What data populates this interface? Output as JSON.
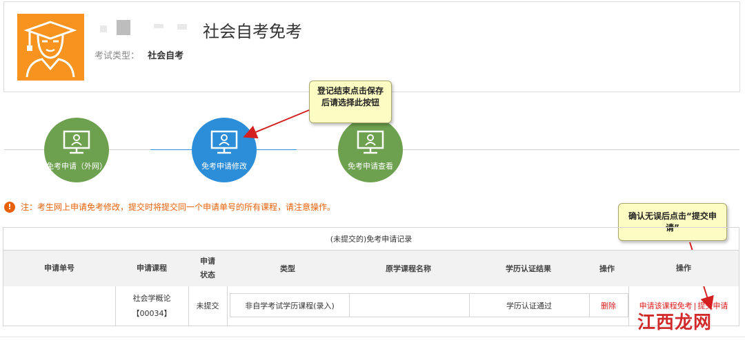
{
  "header": {
    "title": "社会自考免考",
    "exam_type_label": "考试类型：",
    "exam_type_value": "社会自考",
    "avatar_icon": "graduate-avatar-icon",
    "avatar_color": "#f7931e"
  },
  "steps": [
    {
      "label": "免考申请（外网）",
      "state": "done",
      "icon": "monitor-user-icon"
    },
    {
      "label": "免考申请修改",
      "state": "current",
      "icon": "monitor-user-icon"
    },
    {
      "label": "免考申请查看",
      "state": "done",
      "icon": "monitor-user-icon"
    }
  ],
  "callouts": {
    "save_tip": "登记结束点击保存后请选择此按钮",
    "submit_tip": "确认无误后点击“提交申请”"
  },
  "notice": {
    "text": "注：考生网上申请免考修改，提交时将提交同一个申请单号的所有课程，请注意操作。"
  },
  "table": {
    "caption": "(未提交的)免考申请记录",
    "headers": {
      "apply_no": "申请单号",
      "course": "申请课程",
      "status": "申请状态",
      "type": "类型",
      "orig_course": "原学课程名称",
      "cert_result": "学历认证结果",
      "inner_op": "操作",
      "op": "操作"
    },
    "rows": [
      {
        "apply_no": "",
        "course_name": "社会学概论",
        "course_code": "【00034】",
        "status": "未提交",
        "type": "非自学考试学历课程(录入)",
        "orig_course": "",
        "cert_result": "学历认证通过",
        "delete_label": "删除",
        "apply_exempt_label": "申请该课程免考",
        "separator": "|",
        "submit_label": "提交申请"
      }
    ]
  },
  "watermark": "江西龙网",
  "colors": {
    "step_done": "#6ea14f",
    "step_current": "#2c8dd8",
    "notice": "#e8610a",
    "link_red": "#e01b1b",
    "callout_bg": "#fdfcc3"
  }
}
